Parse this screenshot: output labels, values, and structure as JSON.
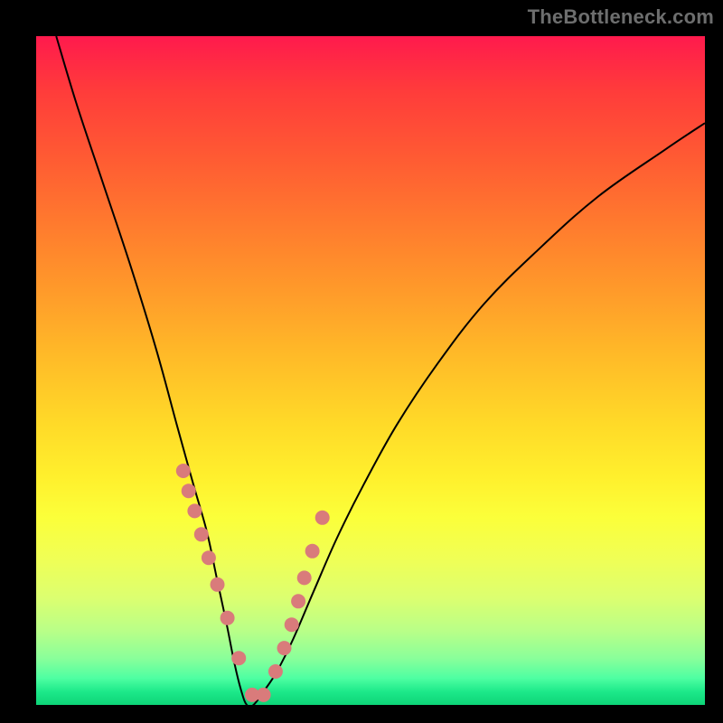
{
  "watermark": "TheBottleneck.com",
  "chart_data": {
    "type": "line",
    "title": "",
    "xlabel": "",
    "ylabel": "",
    "xlim": [
      0,
      100
    ],
    "ylim": [
      0,
      100
    ],
    "grid": false,
    "legend": false,
    "series": [
      {
        "name": "bottleneck-curve",
        "x": [
          3,
          6,
          10,
          14,
          18,
          21,
          23.5,
          25.5,
          27,
          28.5,
          29.7,
          30.7,
          31.5,
          32.5,
          34,
          36,
          38.5,
          41.5,
          45,
          49,
          54,
          60,
          67,
          75,
          84,
          94,
          100
        ],
        "y": [
          100,
          90,
          78,
          66,
          53,
          42,
          33,
          26,
          19,
          12,
          6,
          2,
          0,
          0,
          2,
          5,
          10,
          17,
          25,
          33,
          42,
          51,
          60,
          68,
          76,
          83,
          87
        ]
      }
    ],
    "markers": {
      "name": "highlight-dots",
      "x": [
        22.0,
        22.8,
        23.7,
        24.7,
        25.8,
        27.1,
        28.6,
        30.3,
        32.3,
        34.0,
        35.8,
        37.1,
        38.2,
        39.2,
        40.1,
        41.3,
        42.8
      ],
      "y": [
        35,
        32,
        29,
        25.5,
        22,
        18,
        13,
        7,
        1.5,
        1.5,
        5,
        8.5,
        12,
        15.5,
        19,
        23,
        28
      ]
    }
  },
  "colors": {
    "curve": "#000000",
    "dot": "#d97b7b",
    "gradient_top": "#ff1a4d",
    "gradient_bottom": "#0dd477"
  }
}
